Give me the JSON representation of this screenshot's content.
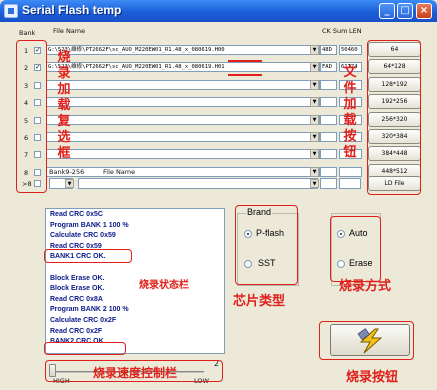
{
  "window": {
    "title": "Serial Flash temp",
    "controls": [
      "_",
      "□",
      "×"
    ]
  },
  "headers": {
    "bank": "Bank",
    "file_name": "File Name",
    "ck_sum": "CK Sum",
    "len": "LEN"
  },
  "banks": [
    {
      "num": "1",
      "checked": true,
      "file": "G:\\523\\维修\\PT2662F\\sc_AUO_M220EW01_R1.48_x_080619.H00",
      "cksum": "48D",
      "len": "50460",
      "button": "64"
    },
    {
      "num": "2",
      "checked": true,
      "file": "G:\\523\\维修\\PT2662F\\sc_AUO_M220EW01_R1.48_x_080619.H01",
      "cksum": "FAD",
      "len": "61774",
      "button": "64*128"
    },
    {
      "num": "3",
      "checked": false,
      "file": "",
      "cksum": "",
      "len": "",
      "button": "128*192"
    },
    {
      "num": "4",
      "checked": false,
      "file": "",
      "cksum": "",
      "len": "",
      "button": "192*256"
    },
    {
      "num": "5",
      "checked": false,
      "file": "",
      "cksum": "",
      "len": "",
      "button": "256*320"
    },
    {
      "num": "6",
      "checked": false,
      "file": "",
      "cksum": "",
      "len": "",
      "button": "320*384"
    },
    {
      "num": "7",
      "checked": false,
      "file": "",
      "cksum": "",
      "len": "",
      "button": "384*448"
    },
    {
      "num": "8",
      "checked": false,
      "file": "",
      "cksum": "",
      "len": "",
      "button": "448*512"
    }
  ],
  "bank9": {
    "label": "Bank9-256",
    "file_label": "File Name",
    "prefix": ">8",
    "ld_file": "LD File"
  },
  "log_lines": [
    "Read CRC        0x5C",
    "Program BANK 1  100 %",
    "Calculate CRC   0x59",
    "Read CRC        0x59",
    "BANK1 CRC OK.",
    "",
    "Block Erase OK.",
    "Block Erase OK.",
    "Read CRC        0x8A",
    "Program BANK 2  100 %",
    "Calculate CRC   0x2F",
    "Read CRC        0x2F",
    "BANK2 CRC OK."
  ],
  "brand": {
    "title": "Brand",
    "options": [
      {
        "label": "P-flash",
        "selected": true
      },
      {
        "label": "SST",
        "selected": false
      }
    ]
  },
  "mode": {
    "options": [
      {
        "label": "Auto",
        "selected": true
      },
      {
        "label": "Erase",
        "selected": false
      }
    ]
  },
  "speed": {
    "high": "HIGH",
    "low": "LOW",
    "value": "2",
    "position_fraction": 0.0
  },
  "annotations": {
    "file_select": "烧录加载复选框",
    "file_load": "文件加载按钮",
    "status_bar": "烧录状态栏",
    "chip_type": "芯片类型",
    "burn_mode": "烧录方式",
    "speed_bar": "烧录速度控制栏",
    "burn_button": "烧录按钮",
    "accent_color": "#e0201a"
  }
}
